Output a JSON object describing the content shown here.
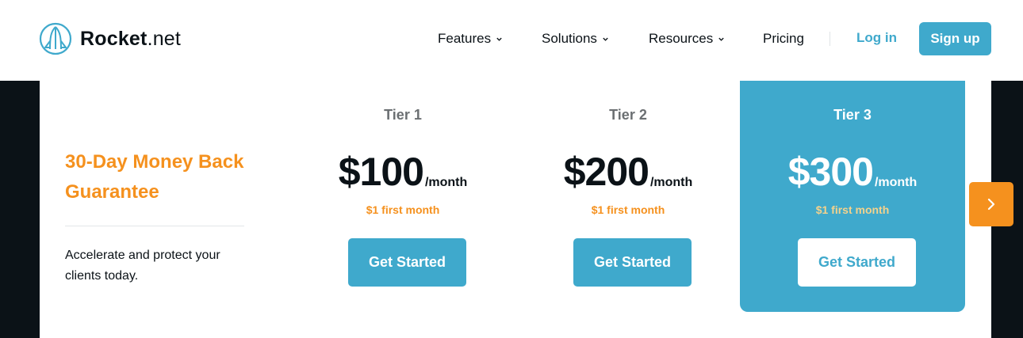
{
  "header": {
    "logo": {
      "brand_bold": "Rocket",
      "brand_light": ".net",
      "icon": "rocket-logo-icon"
    },
    "nav": [
      {
        "label": "Features",
        "has_dropdown": true
      },
      {
        "label": "Solutions",
        "has_dropdown": true
      },
      {
        "label": "Resources",
        "has_dropdown": true
      },
      {
        "label": "Pricing",
        "has_dropdown": false
      }
    ],
    "login_label": "Log in",
    "signup_label": "Sign up"
  },
  "pricing": {
    "guarantee_title": "30-Day Money Back Guarantee",
    "tagline": "Accelerate and protect your clients today.",
    "tiers": [
      {
        "name": "Tier 1",
        "price": "$100",
        "unit": "/month",
        "promo": "$1 first month",
        "cta": "Get Started",
        "highlighted": false
      },
      {
        "name": "Tier 2",
        "price": "$200",
        "unit": "/month",
        "promo": "$1 first month",
        "cta": "Get Started",
        "highlighted": false
      },
      {
        "name": "Tier 3",
        "price": "$300",
        "unit": "/month",
        "promo": "$1 first month",
        "cta": "Get Started",
        "highlighted": true
      }
    ],
    "next_icon": "chevron-right-icon"
  },
  "colors": {
    "accent_blue": "#3fa9cc",
    "accent_orange": "#f5911e",
    "dark": "#0b1217"
  }
}
